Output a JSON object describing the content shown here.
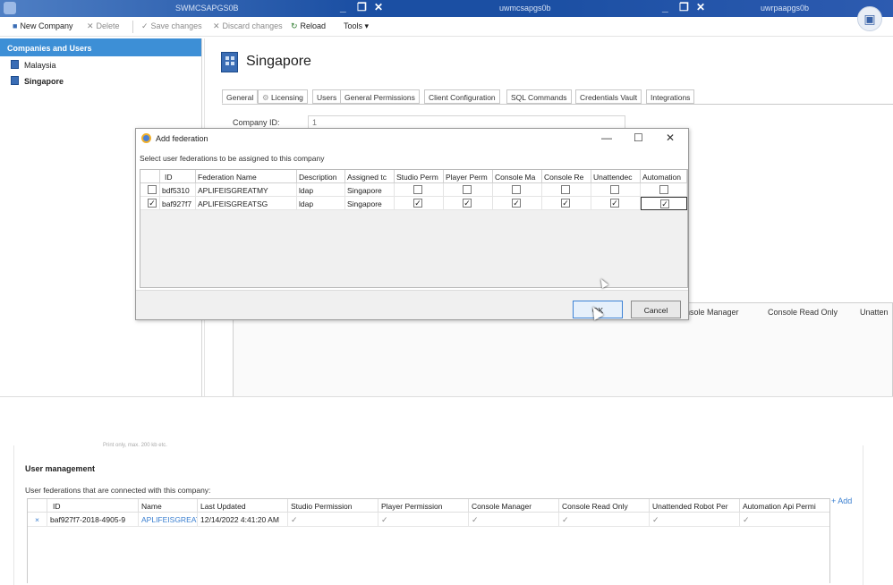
{
  "titlebar": {
    "host1": "SWMCSAPGS0B",
    "host2": "uwmcsapgs0b",
    "host3": "uwrpaapgs0b",
    "min": "_",
    "restore": "❐",
    "close": "✕"
  },
  "toolbar": {
    "new_company": "New Company",
    "delete": "Delete",
    "save_changes": "Save changes",
    "discard_changes": "Discard changes",
    "reload": "Reload",
    "tools": "Tools ▾"
  },
  "sidebar": {
    "header": "Companies and Users",
    "items": [
      {
        "label": "Malaysia"
      },
      {
        "label": "Singapore"
      }
    ]
  },
  "company": {
    "title": "Singapore",
    "tabs": [
      "General",
      "Licensing",
      "Users",
      "General Permissions",
      "Client Configuration",
      "SQL Commands",
      "Credentials Vault",
      "Integrations"
    ],
    "id_label": "Company ID:",
    "id_value": "1"
  },
  "background_panel": {
    "headers": [
      "nsole Manager",
      "Console Read Only",
      "Unatten"
    ]
  },
  "dialog": {
    "title": "Add federation",
    "minimize": "—",
    "maximize": "☐",
    "close": "✕",
    "prompt": "Select user federations to be assigned to this company",
    "columns": [
      "ID",
      "Federation Name",
      "Description",
      "Assigned tc",
      "Studio Perm",
      "Player Perm",
      "Console Ma",
      "Console Re",
      "Unattendec",
      "Automation"
    ],
    "rows": [
      {
        "selected": false,
        "id": "bdf5310",
        "name": "APLIFEISGREATMY",
        "description": "ldap",
        "assigned": "Singapore",
        "perms": [
          false,
          false,
          false,
          false,
          false,
          false
        ]
      },
      {
        "selected": true,
        "id": "baf927f7",
        "name": "APLIFEISGREATSG",
        "description": "ldap",
        "assigned": "Singapore",
        "perms": [
          true,
          true,
          true,
          true,
          true,
          true
        ]
      }
    ],
    "ok": "OK",
    "cancel": "Cancel",
    "check_glyph": "✓"
  },
  "user_management": {
    "faded_note": "Print only, max. 200 kb etc.",
    "title": "User management",
    "subtitle": "User federations that are connected with this company:",
    "columns": [
      "ID",
      "Name",
      "Last Updated",
      "Studio Permission",
      "Player Permission",
      "Console Manager",
      "Console Read Only",
      "Unattended Robot Per",
      "Automation Api Permi"
    ],
    "row": {
      "remove": "×",
      "id": "baf927f7-2018-4905-9",
      "name": "APLIFEISGREAT",
      "last_updated": "12/14/2022 4:41:20 AM",
      "perms": [
        true,
        true,
        true,
        true,
        true,
        true
      ]
    },
    "add": "+ Add"
  },
  "colors": {
    "accent": "#3d8fd6",
    "titlebar": "#1b4fa3",
    "link": "#3a7fd0"
  }
}
